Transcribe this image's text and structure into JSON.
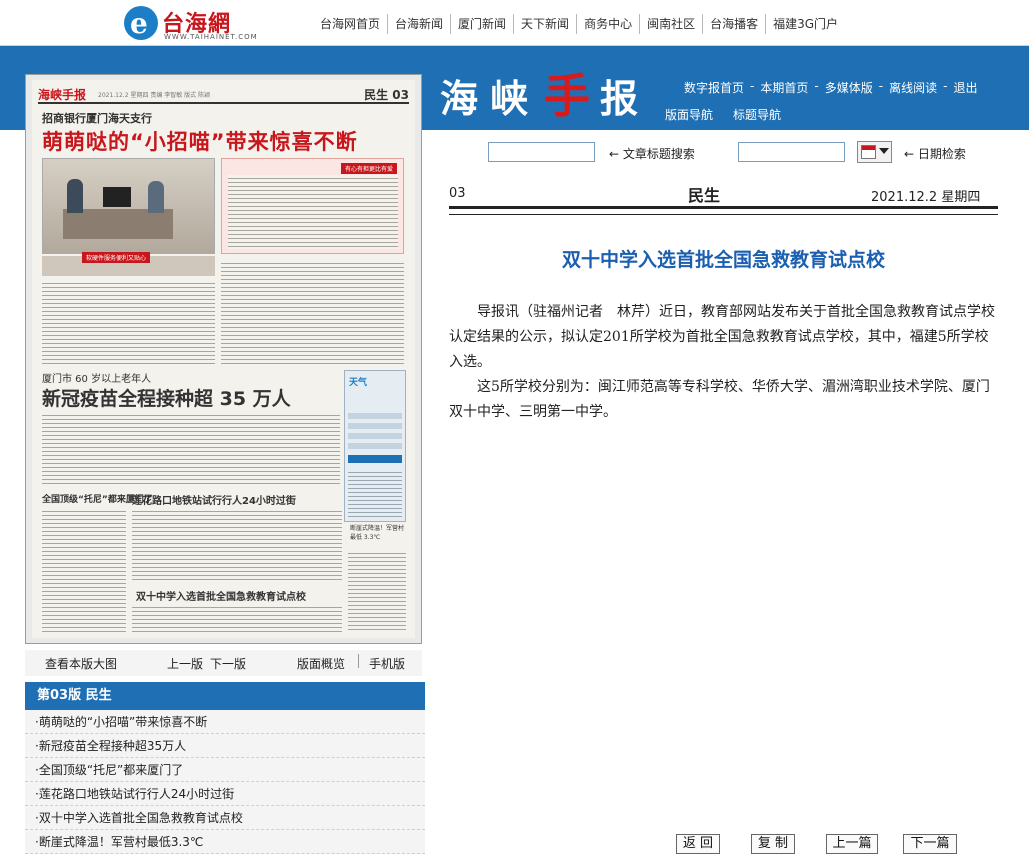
{
  "site": {
    "logo_text": "台海網",
    "logo_url": "WWW.TAIHAINET.COM",
    "logo_glyph": "e",
    "nav": [
      "台海网首页",
      "台海新闻",
      "厦门新闻",
      "天下新闻",
      "商务中心",
      "闽南社区",
      "台海播客",
      "福建3G门户"
    ]
  },
  "epaper": {
    "brand": [
      "海",
      "峡",
      "手",
      "报"
    ],
    "nav_row1": [
      "数字报首页",
      "本期首页",
      "多媒体版",
      "离线阅读",
      "退出"
    ],
    "nav_row1_sep": "-",
    "nav_row2": [
      "版面导航",
      "标题导航"
    ],
    "search_title_label": "← 文章标题搜索",
    "date_search_label": "← 日期检索",
    "page_number": "03",
    "section_name": "民生",
    "date": "2021.12.2",
    "weekday": "星期四"
  },
  "thumbnail": {
    "masthead": "海峡手报",
    "header_date": "2021.12.2 星期四 责编 李智敏 版式 陈颖",
    "section": "民生 03",
    "kicker1": "招商银行厦门海天支行",
    "headline1": "萌萌哒的“小招喵”带来惊喜不断",
    "box_tag": "有心有担更比有爱",
    "photo_caption": "软硬件服务便利又贴心",
    "kicker2": "厦门市 60 岁以上老年人",
    "headline2": "新冠疫苗全程接种超 35 万人",
    "weather_title": "天气",
    "sub1": "全国顶级“托尼”都来厦门了",
    "sub2": "莲花路口地铁站试行行人24小时过街",
    "sub3": "断崖式降温！军营村最低 3.3℃",
    "sub4": "双十中学入选首批全国急救教育试点校"
  },
  "pager": {
    "view_large": "查看本版大图",
    "prev": "上一版",
    "next": "下一版",
    "overview": "版面概览",
    "mobile": "手机版"
  },
  "section_list": {
    "header": "第03版  民生",
    "items": [
      "·萌萌哒的“小招喵”带来惊喜不断",
      "·新冠疫苗全程接种超35万人",
      "·全国顶级“托尼”都来厦门了",
      "·莲花路口地铁站试行行人24小时过街",
      "·双十中学入选首批全国急救教育试点校",
      "·断崖式降温！军营村最低3.3℃"
    ]
  },
  "article": {
    "title": "双十中学入选首批全国急救教育试点校",
    "paragraphs": [
      "导报讯（驻福州记者　林芹）近日，教育部网站发布关于首批全国急救教育试点学校认定结果的公示，拟认定201所学校为首批全国急救教育试点学校，其中，福建5所学校入选。",
      "这5所学校分别为：闽江师范高等专科学校、华侨大学、湄洲湾职业技术学院、厦门双十中学、三明第一中学。"
    ]
  },
  "buttons": {
    "back": "返 回",
    "copy": "复 制",
    "prev": "上一篇",
    "next": "下一篇"
  },
  "colors": {
    "brand_blue": "#1f6fb5",
    "logo_red": "#c8161d",
    "title_blue": "#1b5fb0"
  }
}
